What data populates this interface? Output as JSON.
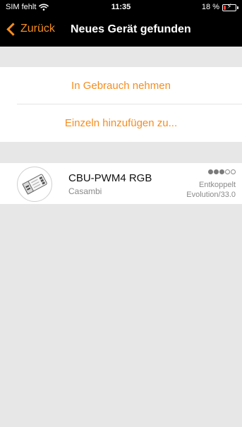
{
  "status_bar": {
    "carrier": "SIM fehlt",
    "time": "11:35",
    "battery_percent": "18 %",
    "battery_level": 0.18
  },
  "nav": {
    "back_label": "Zurück",
    "title": "Neues Gerät gefunden"
  },
  "actions": {
    "items": [
      {
        "label": "In Gebrauch nehmen"
      },
      {
        "label": "Einzeln hinzufügen zu..."
      }
    ]
  },
  "device": {
    "name": "CBU-PWM4 RGB",
    "vendor": "Casambi",
    "status": "Entkoppelt",
    "firmware": "Evolution/33.0",
    "signal_strength": {
      "filled": 3,
      "total": 5
    }
  },
  "colors": {
    "accent": "#f58d1e",
    "background": "#e7e7e7",
    "bar": "#000000"
  }
}
